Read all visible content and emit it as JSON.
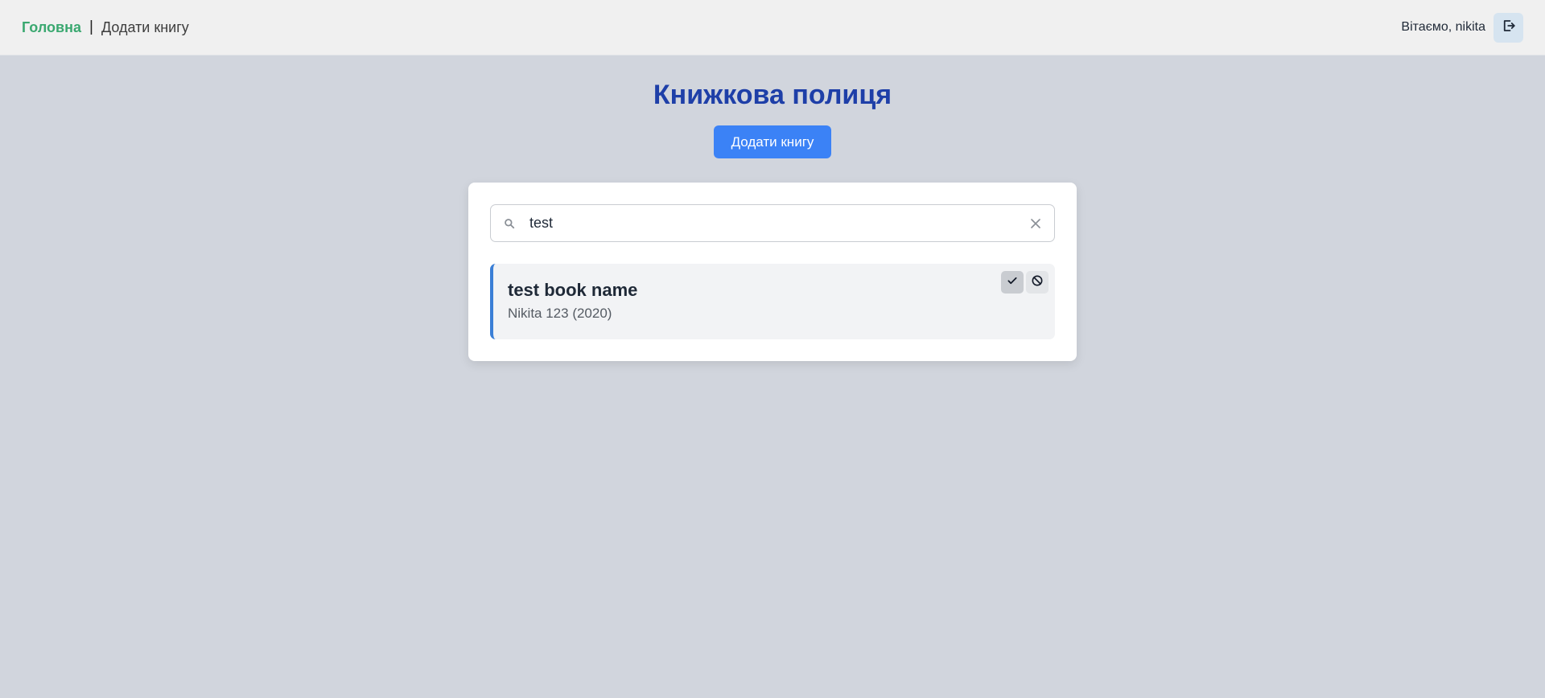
{
  "nav": {
    "home_label": "Головна",
    "separator": "|",
    "add_book_label": "Додати книгу",
    "greeting": "Вітаємо, nikita",
    "logout_icon": "logout-icon"
  },
  "main": {
    "title": "Книжкова полиця",
    "add_book_button": "Додати книгу"
  },
  "search": {
    "value": "test",
    "icon": "search-icon",
    "clear_icon": "close-icon"
  },
  "books": [
    {
      "title": "test book name",
      "meta": "Nikita 123 (2020)",
      "actions": [
        "check-icon",
        "ban-icon"
      ]
    }
  ],
  "colors": {
    "background": "#d1d5dd",
    "navbar": "#f0f0f0",
    "home_link": "#3aa870",
    "title": "#1e3fa8",
    "primary_button": "#3b82f6",
    "book_accent": "#3b7fd6"
  }
}
